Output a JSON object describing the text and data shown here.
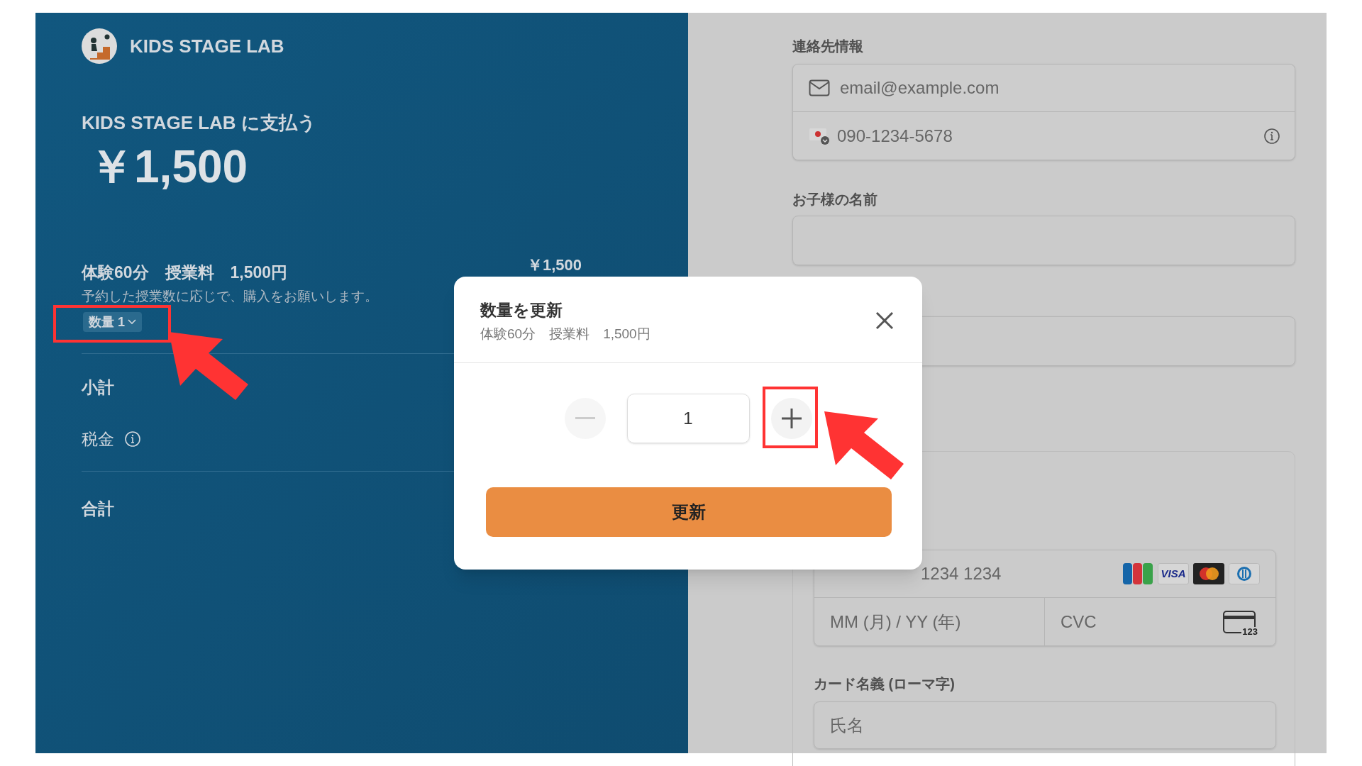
{
  "merchant": {
    "name": "KIDS STAGE LAB"
  },
  "summary": {
    "pay_to": "KIDS STAGE LAB に支払う",
    "amount": "￥1,500",
    "line_item": {
      "name": "体験60分　授業料　1,500円",
      "price": "￥1,500",
      "description": "予約した授業数に応じで、購入をお願いします。",
      "quantity_button": "数量 1"
    },
    "subtotal_label": "小計",
    "tax_label": "税金",
    "total_label": "合計"
  },
  "contact": {
    "heading": "連絡先情報",
    "email_placeholder": "email@example.com",
    "phone_placeholder": "090-1234-5678"
  },
  "child_name": {
    "label": "お子様の名前"
  },
  "card": {
    "number_placeholder": "1234 1234",
    "brands": [
      {
        "kind": "jcb"
      },
      {
        "kind": "visa",
        "text": "VISA"
      },
      {
        "kind": "mastercard"
      },
      {
        "kind": "diners"
      }
    ],
    "expiry_placeholder": "MM (月) / YY (年)",
    "cvc_placeholder": "CVC",
    "cvc_icon_text": "123",
    "holder_label": "カード名義 (ローマ字)",
    "holder_placeholder": "氏名"
  },
  "modal": {
    "title": "数量を更新",
    "subtitle": "体験60分　授業料　1,500円",
    "quantity": "1",
    "minus_disabled": true,
    "submit": "更新"
  }
}
